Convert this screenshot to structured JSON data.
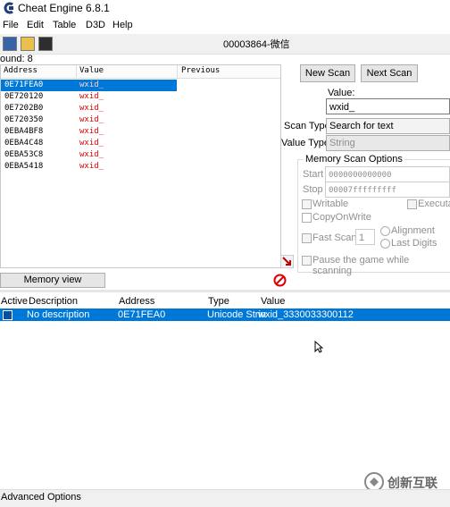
{
  "window": {
    "title": "Cheat Engine 6.8.1",
    "process": "00003864-微信"
  },
  "menu": [
    "File",
    "Edit",
    "Table",
    "D3D",
    "Help"
  ],
  "found": "ound: 8",
  "results": {
    "headers": [
      "Address",
      "Value",
      "Previous"
    ],
    "rows": [
      {
        "address": "0E71FEA0",
        "value": "wxid_"
      },
      {
        "address": "0E720120",
        "value": "wxid_"
      },
      {
        "address": "0E7202B0",
        "value": "wxid_"
      },
      {
        "address": "0E720350",
        "value": "wxid_"
      },
      {
        "address": "0EBA4BF8",
        "value": "wxid_"
      },
      {
        "address": "0EBA4C48",
        "value": "wxid_"
      },
      {
        "address": "0EBA53C8",
        "value": "wxid_"
      },
      {
        "address": "0EBA5418",
        "value": "wxid_"
      }
    ]
  },
  "scan": {
    "new_scan": "New Scan",
    "next_scan": "Next Scan",
    "value_label": "Value:",
    "value": "wxid_",
    "scan_type_label": "Scan Type",
    "scan_type": "Search for text",
    "value_type_label": "Value Type",
    "value_type": "String"
  },
  "options": {
    "title": "Memory Scan Options",
    "start_label": "Start",
    "start": "0000000000000",
    "stop_label": "Stop",
    "stop": "00007fffffffff",
    "writable": "Writable",
    "executable": "Executa",
    "copy_on_write": "CopyOnWrite",
    "fast_scan": "Fast Scan",
    "fast_scan_value": "1",
    "alignment": "Alignment",
    "last_digits": "Last Digits",
    "pause": "Pause the game while scanning"
  },
  "memory_view": "Memory view",
  "address_list": {
    "headers": [
      "Active",
      "Description",
      "Address",
      "Type",
      "Value"
    ],
    "row": {
      "description": "No description",
      "address": "0E71FEA0",
      "type": "Unicode Strin",
      "value": "wxid_3330033300112"
    }
  },
  "advanced_options": "Advanced Options",
  "watermark": "创新互联",
  "colors": {
    "selection": "#0078d7",
    "value_text": "#e00000"
  }
}
